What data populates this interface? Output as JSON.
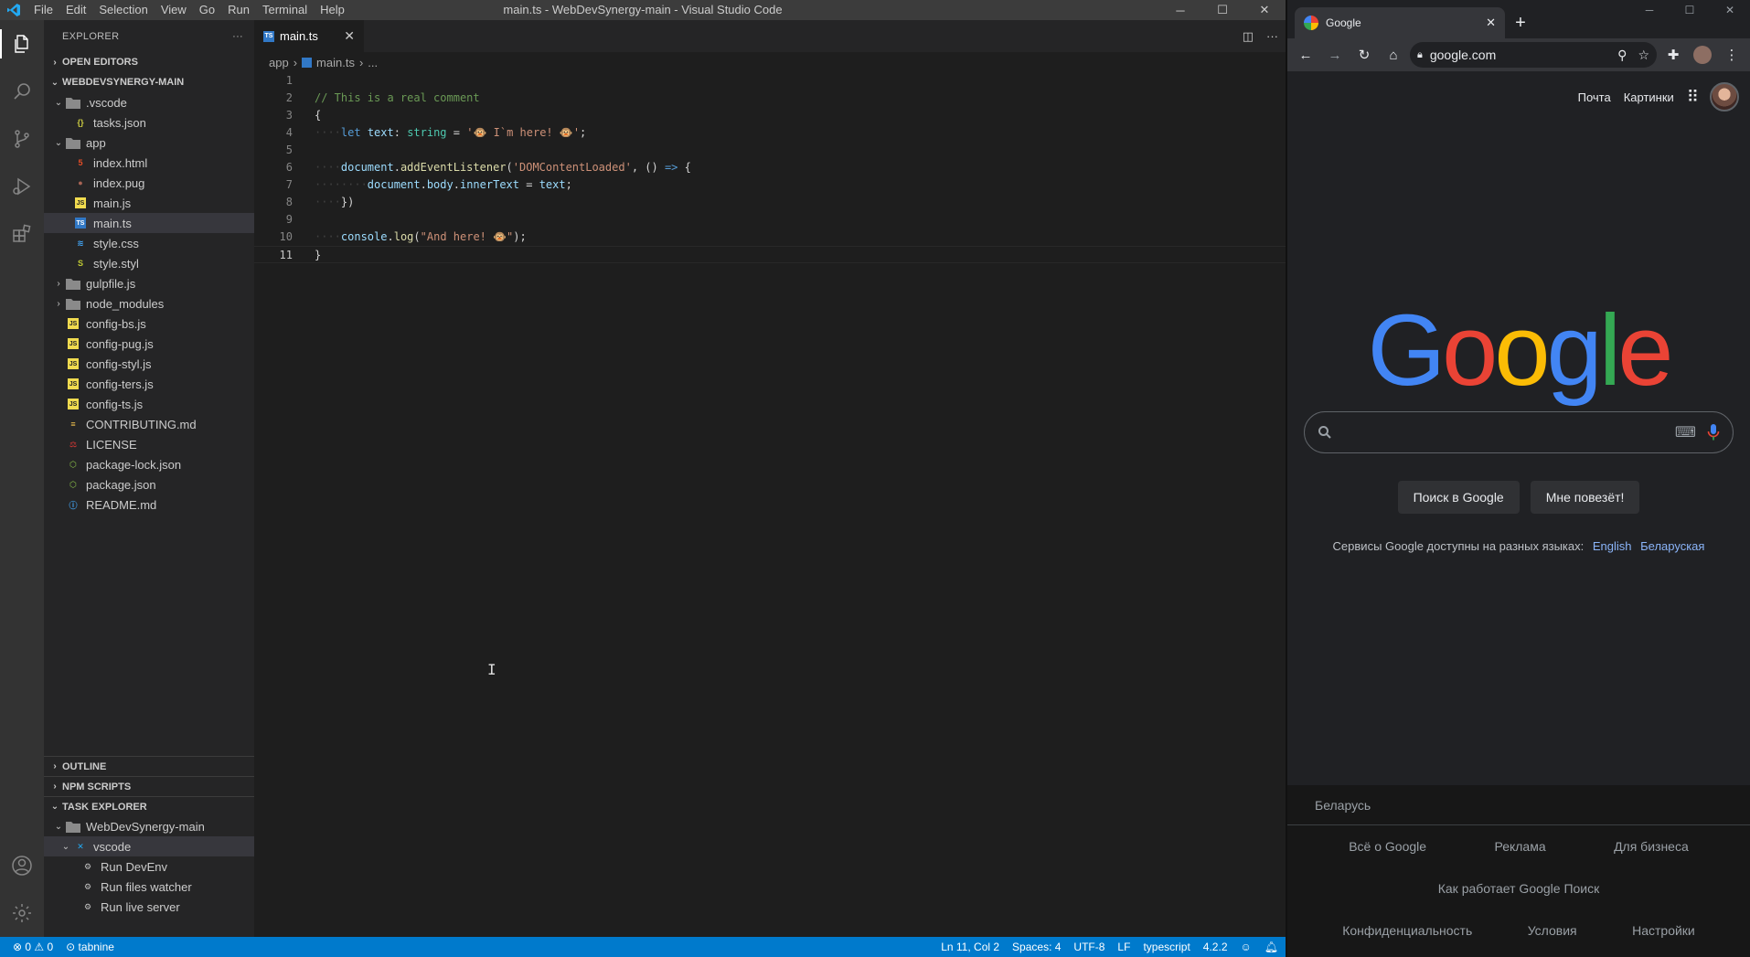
{
  "vscode": {
    "menu": [
      "File",
      "Edit",
      "Selection",
      "View",
      "Go",
      "Run",
      "Terminal",
      "Help"
    ],
    "window_title": "main.ts - WebDevSynergy-main - Visual Studio Code",
    "explorer_title": "EXPLORER",
    "open_editors": "OPEN EDITORS",
    "project": "WEBDEVSYNERGY-MAIN",
    "tree": [
      {
        "label": ".vscode",
        "kind": "folder",
        "depth": 1,
        "open": true
      },
      {
        "label": "tasks.json",
        "kind": "json",
        "depth": 2
      },
      {
        "label": "app",
        "kind": "folder",
        "depth": 1,
        "open": true
      },
      {
        "label": "index.html",
        "kind": "html",
        "depth": 2
      },
      {
        "label": "index.pug",
        "kind": "pug",
        "depth": 2
      },
      {
        "label": "main.js",
        "kind": "js",
        "depth": 2
      },
      {
        "label": "main.ts",
        "kind": "ts",
        "depth": 2,
        "selected": true
      },
      {
        "label": "style.css",
        "kind": "css",
        "depth": 2
      },
      {
        "label": "style.styl",
        "kind": "styl",
        "depth": 2
      },
      {
        "label": "gulpfile.js",
        "kind": "folder",
        "depth": 1
      },
      {
        "label": "node_modules",
        "kind": "folder",
        "depth": 1
      },
      {
        "label": "config-bs.js",
        "kind": "js",
        "depth": 1
      },
      {
        "label": "config-pug.js",
        "kind": "js",
        "depth": 1
      },
      {
        "label": "config-styl.js",
        "kind": "js",
        "depth": 1
      },
      {
        "label": "config-ters.js",
        "kind": "js",
        "depth": 1
      },
      {
        "label": "config-ts.js",
        "kind": "js",
        "depth": 1
      },
      {
        "label": "CONTRIBUTING.md",
        "kind": "md",
        "depth": 1
      },
      {
        "label": "LICENSE",
        "kind": "license",
        "depth": 1
      },
      {
        "label": "package-lock.json",
        "kind": "npm",
        "depth": 1
      },
      {
        "label": "package.json",
        "kind": "npm",
        "depth": 1
      },
      {
        "label": "README.md",
        "kind": "info",
        "depth": 1
      }
    ],
    "outline": "OUTLINE",
    "npm_scripts": "NPM SCRIPTS",
    "task_explorer": "TASK EXPLORER",
    "task_root": "WebDevSynergy-main",
    "task_group": "vscode",
    "tasks": [
      "Run DevEnv",
      "Run files watcher",
      "Run live server"
    ],
    "tab_label": "main.ts",
    "breadcrumb": [
      "app",
      "main.ts",
      "..."
    ],
    "code_lines": [
      {
        "n": "1",
        "html": ""
      },
      {
        "n": "2",
        "html": "<span class='tk-comment'>// This is a real comment</span>"
      },
      {
        "n": "3",
        "html": "<span class='tk-punc'>{</span>"
      },
      {
        "n": "4",
        "html": "<span class='ws'>····</span><span class='tk-kw'>let</span> <span class='tk-var'>text</span>: <span class='tk-type'>string</span> = <span class='tk-str'>'🐵 I`m here! 🐵'</span>;"
      },
      {
        "n": "5",
        "html": ""
      },
      {
        "n": "6",
        "html": "<span class='ws'>····</span><span class='tk-var'>document</span>.<span class='tk-fn'>addEventListener</span>(<span class='tk-str'>'DOMContentLoaded'</span>, () <span class='tk-kw'>=&gt;</span> {"
      },
      {
        "n": "7",
        "html": "<span class='ws'>········</span><span class='tk-var'>document</span>.<span class='tk-var'>body</span>.<span class='tk-var'>innerText</span> = <span class='tk-var'>text</span>;"
      },
      {
        "n": "8",
        "html": "<span class='ws'>····</span>})"
      },
      {
        "n": "9",
        "html": ""
      },
      {
        "n": "10",
        "html": "<span class='ws'>····</span><span class='tk-var'>console</span>.<span class='tk-fn'>log</span>(<span class='tk-str'>\"And here! 🐵\"</span>);"
      },
      {
        "n": "11",
        "html": "<span class='tk-punc'>}</span>"
      }
    ],
    "status": {
      "problems": "⊗ 0 ⚠ 0",
      "tabnine": "⊙ tabnine",
      "position": "Ln 11, Col 2",
      "spaces": "Spaces: 4",
      "encoding": "UTF-8",
      "eol": "LF",
      "language": "typescript",
      "ts_version": "4.2.2"
    }
  },
  "chrome": {
    "tab_title": "Google",
    "url": "google.com",
    "top_links": [
      "Почта",
      "Картинки"
    ],
    "logo_letters": [
      {
        "ch": "G",
        "color": "#4285f4"
      },
      {
        "ch": "o",
        "color": "#ea4335"
      },
      {
        "ch": "o",
        "color": "#fbbc05"
      },
      {
        "ch": "g",
        "color": "#4285f4"
      },
      {
        "ch": "l",
        "color": "#34a853"
      },
      {
        "ch": "e",
        "color": "#ea4335"
      }
    ],
    "search_btn": "Поиск в Google",
    "lucky_btn": "Мне повезёт!",
    "langs_text": "Сервисы Google доступны на разных языках:",
    "lang_links": [
      "English",
      "Беларуская"
    ],
    "country": "Беларусь",
    "footer_row1": [
      "Всё о Google",
      "Реклама",
      "Для бизнеса"
    ],
    "footer_row2": [
      "Как работает Google Поиск"
    ],
    "footer_row3": [
      "Конфиденциальность",
      "Условия",
      "Настройки"
    ]
  }
}
